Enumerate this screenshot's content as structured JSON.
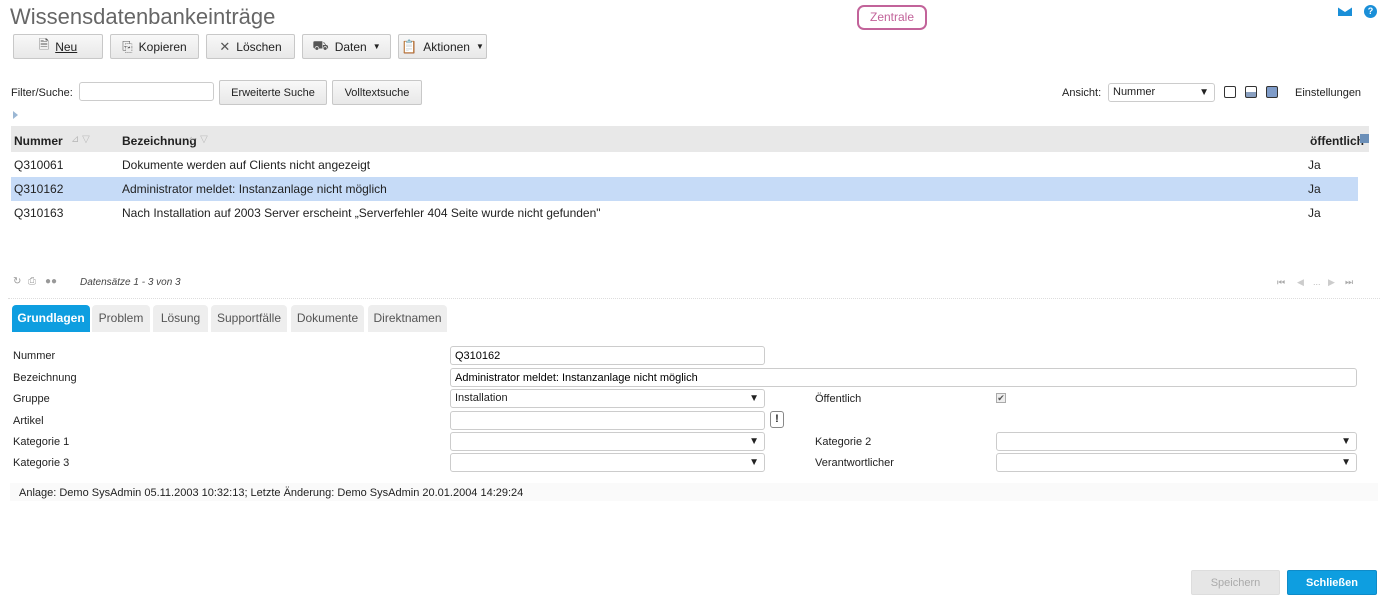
{
  "title": "Wissensdatenbankeinträge",
  "location_badge": "Zentrale",
  "toolbar": {
    "new": "Neu",
    "copy": "Kopieren",
    "delete": "Löschen",
    "data": "Daten",
    "actions": "Aktionen"
  },
  "filter": {
    "label": "Filter/Suche:",
    "value": "",
    "advanced": "Erweiterte Suche",
    "fulltext": "Volltextsuche"
  },
  "view": {
    "label": "Ansicht:",
    "selected": "Nummer",
    "settings": "Einstellungen"
  },
  "table": {
    "columns": [
      "Nummer",
      "Bezeichnung",
      "öffentlich"
    ],
    "rows": [
      {
        "nummer": "Q310061",
        "bezeichnung": "Dokumente werden auf Clients nicht angezeigt",
        "oeffentlich": "Ja"
      },
      {
        "nummer": "Q310162",
        "bezeichnung": "Administrator meldet: Instanzanlage nicht möglich",
        "oeffentlich": "Ja"
      },
      {
        "nummer": "Q310163",
        "bezeichnung": "Nach Installation auf 2003 Server erscheint „Serverfehler 404 Seite wurde nicht gefunden\"",
        "oeffentlich": "Ja"
      }
    ],
    "selected_index": 1
  },
  "pager": {
    "records": "Datensätze 1 - 3 von 3",
    "ellipsis": "..."
  },
  "tabs": [
    "Grundlagen",
    "Problem",
    "Lösung",
    "Supportfälle",
    "Dokumente",
    "Direktnamen"
  ],
  "form": {
    "nummer_label": "Nummer",
    "nummer": "Q310162",
    "bezeichnung_label": "Bezeichnung",
    "bezeichnung": "Administrator meldet: Instanzanlage nicht möglich",
    "gruppe_label": "Gruppe",
    "gruppe": "Installation",
    "oeffentlich_label": "Öffentlich",
    "oeffentlich": true,
    "artikel_label": "Artikel",
    "artikel": "",
    "kat1_label": "Kategorie 1",
    "kat1": "",
    "kat2_label": "Kategorie 2",
    "kat2": "",
    "kat3_label": "Kategorie 3",
    "kat3": "",
    "verantw_label": "Verantwortlicher",
    "verantw": ""
  },
  "audit": "Anlage: Demo SysAdmin 05.11.2003 10:32:13; Letzte Änderung: Demo SysAdmin 20.01.2004 14:29:24",
  "footer": {
    "save": "Speichern",
    "close": "Schließen"
  }
}
